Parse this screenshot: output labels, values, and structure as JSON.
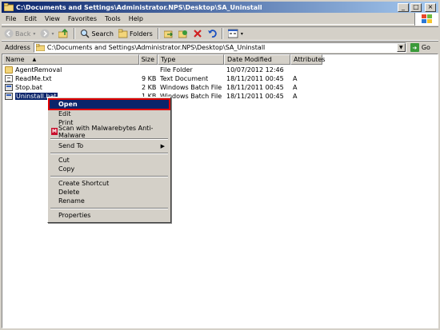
{
  "window": {
    "title": "C:\\Documents and Settings\\Administrator.NPS\\Desktop\\SA_Uninstall",
    "controls": {
      "minimize": "_",
      "maximize": "□",
      "close": "×"
    }
  },
  "menubar": {
    "items": [
      "File",
      "Edit",
      "View",
      "Favorites",
      "Tools",
      "Help"
    ]
  },
  "toolbar": {
    "back_label": "Back",
    "search_label": "Search",
    "folders_label": "Folders"
  },
  "address": {
    "label": "Address",
    "value": "C:\\Documents and Settings\\Administrator.NPS\\Desktop\\SA_Uninstall",
    "go_label": "Go"
  },
  "listview": {
    "columns": [
      "Name",
      "Size",
      "Type",
      "Date Modified",
      "Attributes"
    ],
    "rows": [
      {
        "name": "AgentRemoval",
        "size": "",
        "type": "File Folder",
        "modified": "10/07/2012 12:46",
        "attributes": "",
        "icon": "folder-icon"
      },
      {
        "name": "ReadMe.txt",
        "size": "9 KB",
        "type": "Text Document",
        "modified": "18/11/2011 00:45",
        "attributes": "A",
        "icon": "text-file-icon"
      },
      {
        "name": "Stop.bat",
        "size": "2 KB",
        "type": "Windows Batch File",
        "modified": "18/11/2011 00:45",
        "attributes": "A",
        "icon": "batch-file-icon"
      },
      {
        "name": "Uninstall.bat",
        "size": "1 KB",
        "type": "Windows Batch File",
        "modified": "18/11/2011 00:45",
        "attributes": "A",
        "icon": "batch-file-icon",
        "selected": true
      }
    ]
  },
  "context_menu": {
    "open": "Open",
    "edit": "Edit",
    "print": "Print",
    "scan": "Scan with Malwarebytes Anti-Malware",
    "send_to": "Send To",
    "cut": "Cut",
    "copy": "Copy",
    "create_shortcut": "Create Shortcut",
    "delete": "Delete",
    "rename": "Rename",
    "properties": "Properties"
  },
  "colors": {
    "titlebar_start": "#0a246a",
    "selection": "#0a246a",
    "highlight_box": "#e00000"
  }
}
